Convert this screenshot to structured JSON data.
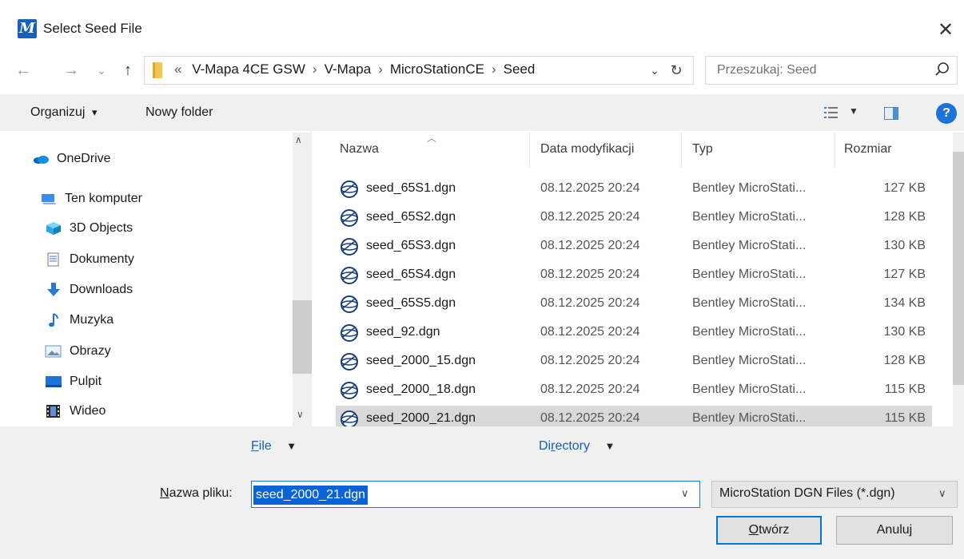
{
  "window": {
    "title": "Select Seed File",
    "app_icon": "microstation-icon",
    "close_glyph": "✕"
  },
  "nav_buttons": {
    "back": "←",
    "forward": "→",
    "recent": "⌄",
    "up": "↑"
  },
  "address": {
    "overflow": "«",
    "crumbs": [
      "V-Mapa 4CE GSW",
      "V-Mapa",
      "MicroStationCE",
      "Seed"
    ],
    "separator": "›"
  },
  "search": {
    "placeholder": "Przeszukaj: Seed"
  },
  "toolbar": {
    "organize": "Organizuj",
    "organize_caret": "▾",
    "new_folder": "Nowy folder"
  },
  "nav_pane": {
    "items": [
      {
        "label": "OneDrive",
        "icon": "onedrive-icon"
      },
      {
        "label": "Ten komputer",
        "icon": "computer-icon"
      },
      {
        "label": "3D Objects",
        "icon": "3d-objects-icon"
      },
      {
        "label": "Dokumenty",
        "icon": "documents-icon"
      },
      {
        "label": "Downloads",
        "icon": "downloads-icon"
      },
      {
        "label": "Muzyka",
        "icon": "music-icon"
      },
      {
        "label": "Obrazy",
        "icon": "pictures-icon"
      },
      {
        "label": "Pulpit",
        "icon": "desktop-icon"
      },
      {
        "label": "Wideo",
        "icon": "video-icon"
      }
    ]
  },
  "file_list": {
    "columns": {
      "name": "Nazwa",
      "date": "Data modyfikacji",
      "type": "Typ",
      "size": "Rozmiar"
    },
    "rows": [
      {
        "name": "seed_65S1.dgn",
        "date": "08.12.2025 20:24",
        "type": "Bentley MicroStati...",
        "size": "127 KB"
      },
      {
        "name": "seed_65S2.dgn",
        "date": "08.12.2025 20:24",
        "type": "Bentley MicroStati...",
        "size": "128 KB"
      },
      {
        "name": "seed_65S3.dgn",
        "date": "08.12.2025 20:24",
        "type": "Bentley MicroStati...",
        "size": "130 KB"
      },
      {
        "name": "seed_65S4.dgn",
        "date": "08.12.2025 20:24",
        "type": "Bentley MicroStati...",
        "size": "127 KB"
      },
      {
        "name": "seed_65S5.dgn",
        "date": "08.12.2025 20:24",
        "type": "Bentley MicroStati...",
        "size": "134 KB"
      },
      {
        "name": "seed_92.dgn",
        "date": "08.12.2025 20:24",
        "type": "Bentley MicroStati...",
        "size": "130 KB"
      },
      {
        "name": "seed_2000_15.dgn",
        "date": "08.12.2025 20:24",
        "type": "Bentley MicroStati...",
        "size": "128 KB"
      },
      {
        "name": "seed_2000_18.dgn",
        "date": "08.12.2025 20:24",
        "type": "Bentley MicroStati...",
        "size": "115 KB"
      },
      {
        "name": "seed_2000_21.dgn",
        "date": "08.12.2025 20:24",
        "type": "Bentley MicroStati...",
        "size": "115 KB",
        "selected": true
      }
    ]
  },
  "bottom": {
    "file_menu": {
      "accel": "F",
      "rest": "ile"
    },
    "directory_menu": {
      "pre": "Di",
      "accel": "r",
      "rest": "ectory"
    },
    "filename_label": {
      "accel": "N",
      "rest": "azwa pliku:"
    },
    "filename_value": "seed_2000_21.dgn",
    "filter": "MicroStation DGN Files (*.dgn)",
    "open": {
      "accel": "O",
      "rest": "twórz"
    },
    "cancel": "Anuluj"
  },
  "colors": {
    "accent": "#0078d7",
    "selection": "#0a64d8",
    "row_selected": "#d9d9d9"
  }
}
